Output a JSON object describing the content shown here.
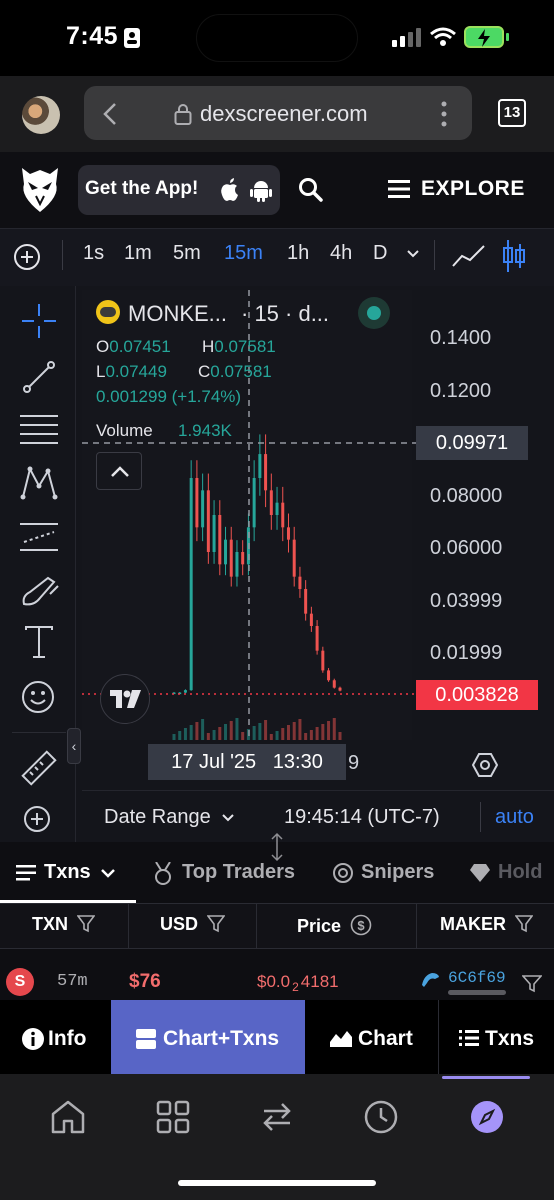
{
  "status_bar": {
    "time": "7:45"
  },
  "browser": {
    "url": "dexscreener.com",
    "tab_count": "13"
  },
  "header": {
    "get_app_label": "Get the App!",
    "explore_label": "EXPLORE"
  },
  "timeframes": [
    {
      "label": "1s"
    },
    {
      "label": "1m"
    },
    {
      "label": "5m"
    },
    {
      "label": "15m",
      "active": true
    },
    {
      "label": "1h"
    },
    {
      "label": "4h"
    },
    {
      "label": "D"
    }
  ],
  "chart": {
    "symbol": "MONKE...",
    "interval_text": "· 15 · d...",
    "ohlc": {
      "o_label": "O",
      "o": "0.07451",
      "h_label": "H",
      "h": "0.07581",
      "l_label": "L",
      "l": "0.07449",
      "c_label": "C",
      "c": "0.07581"
    },
    "change": "0.001299 (+1.74%)",
    "volume_label": "Volume",
    "volume_value": "1.943K",
    "price_ticks": [
      "0.1400",
      "0.1200",
      "0.08000",
      "0.06000",
      "0.03999",
      "0.01999"
    ],
    "crosshair_price": "0.09971",
    "last_price": "0.003828",
    "crosshair_time": "17 Jul '25   13:30",
    "axis_partial": "9",
    "date_range_label": "Date Range",
    "clock": "19:45:14 (UTC-7)",
    "auto_label": "auto",
    "colors": {
      "up": "#26a69a",
      "down": "#ef5350",
      "accent": "#3b82f6",
      "last_price_bg": "#f23645"
    }
  },
  "chart_data": {
    "type": "line",
    "title": "",
    "xlabel": "",
    "ylabel": "",
    "series": [
      {
        "values": [
          0.003,
          0.003,
          0.004,
          0.09,
          0.07,
          0.085,
          0.06,
          0.075,
          0.055,
          0.065,
          0.05,
          0.06,
          0.055,
          0.07,
          0.09,
          0.0997,
          0.085,
          0.075,
          0.08,
          0.07,
          0.065,
          0.05,
          0.045,
          0.035,
          0.03,
          0.02,
          0.012,
          0.008,
          0.005,
          0.0038
        ]
      }
    ],
    "ylim": [
      0,
      0.15
    ],
    "grid": false
  },
  "txns": {
    "tabs": [
      {
        "label": "Txns"
      },
      {
        "label": "Top Traders"
      },
      {
        "label": "Snipers"
      },
      {
        "label": "Hold"
      }
    ],
    "columns": [
      "TXN",
      "USD",
      "Price",
      "MAKER"
    ],
    "rows": [
      {
        "type": "S",
        "age": "57m",
        "usd": "$76",
        "price_a": "$0.0",
        "price_sub": "2",
        "price_b": "4181",
        "maker": "6C6f69"
      }
    ]
  },
  "view_tabs": [
    {
      "label": "Info"
    },
    {
      "label": "Chart+Txns",
      "active": true
    },
    {
      "label": "Chart"
    },
    {
      "label": "Txns"
    }
  ]
}
